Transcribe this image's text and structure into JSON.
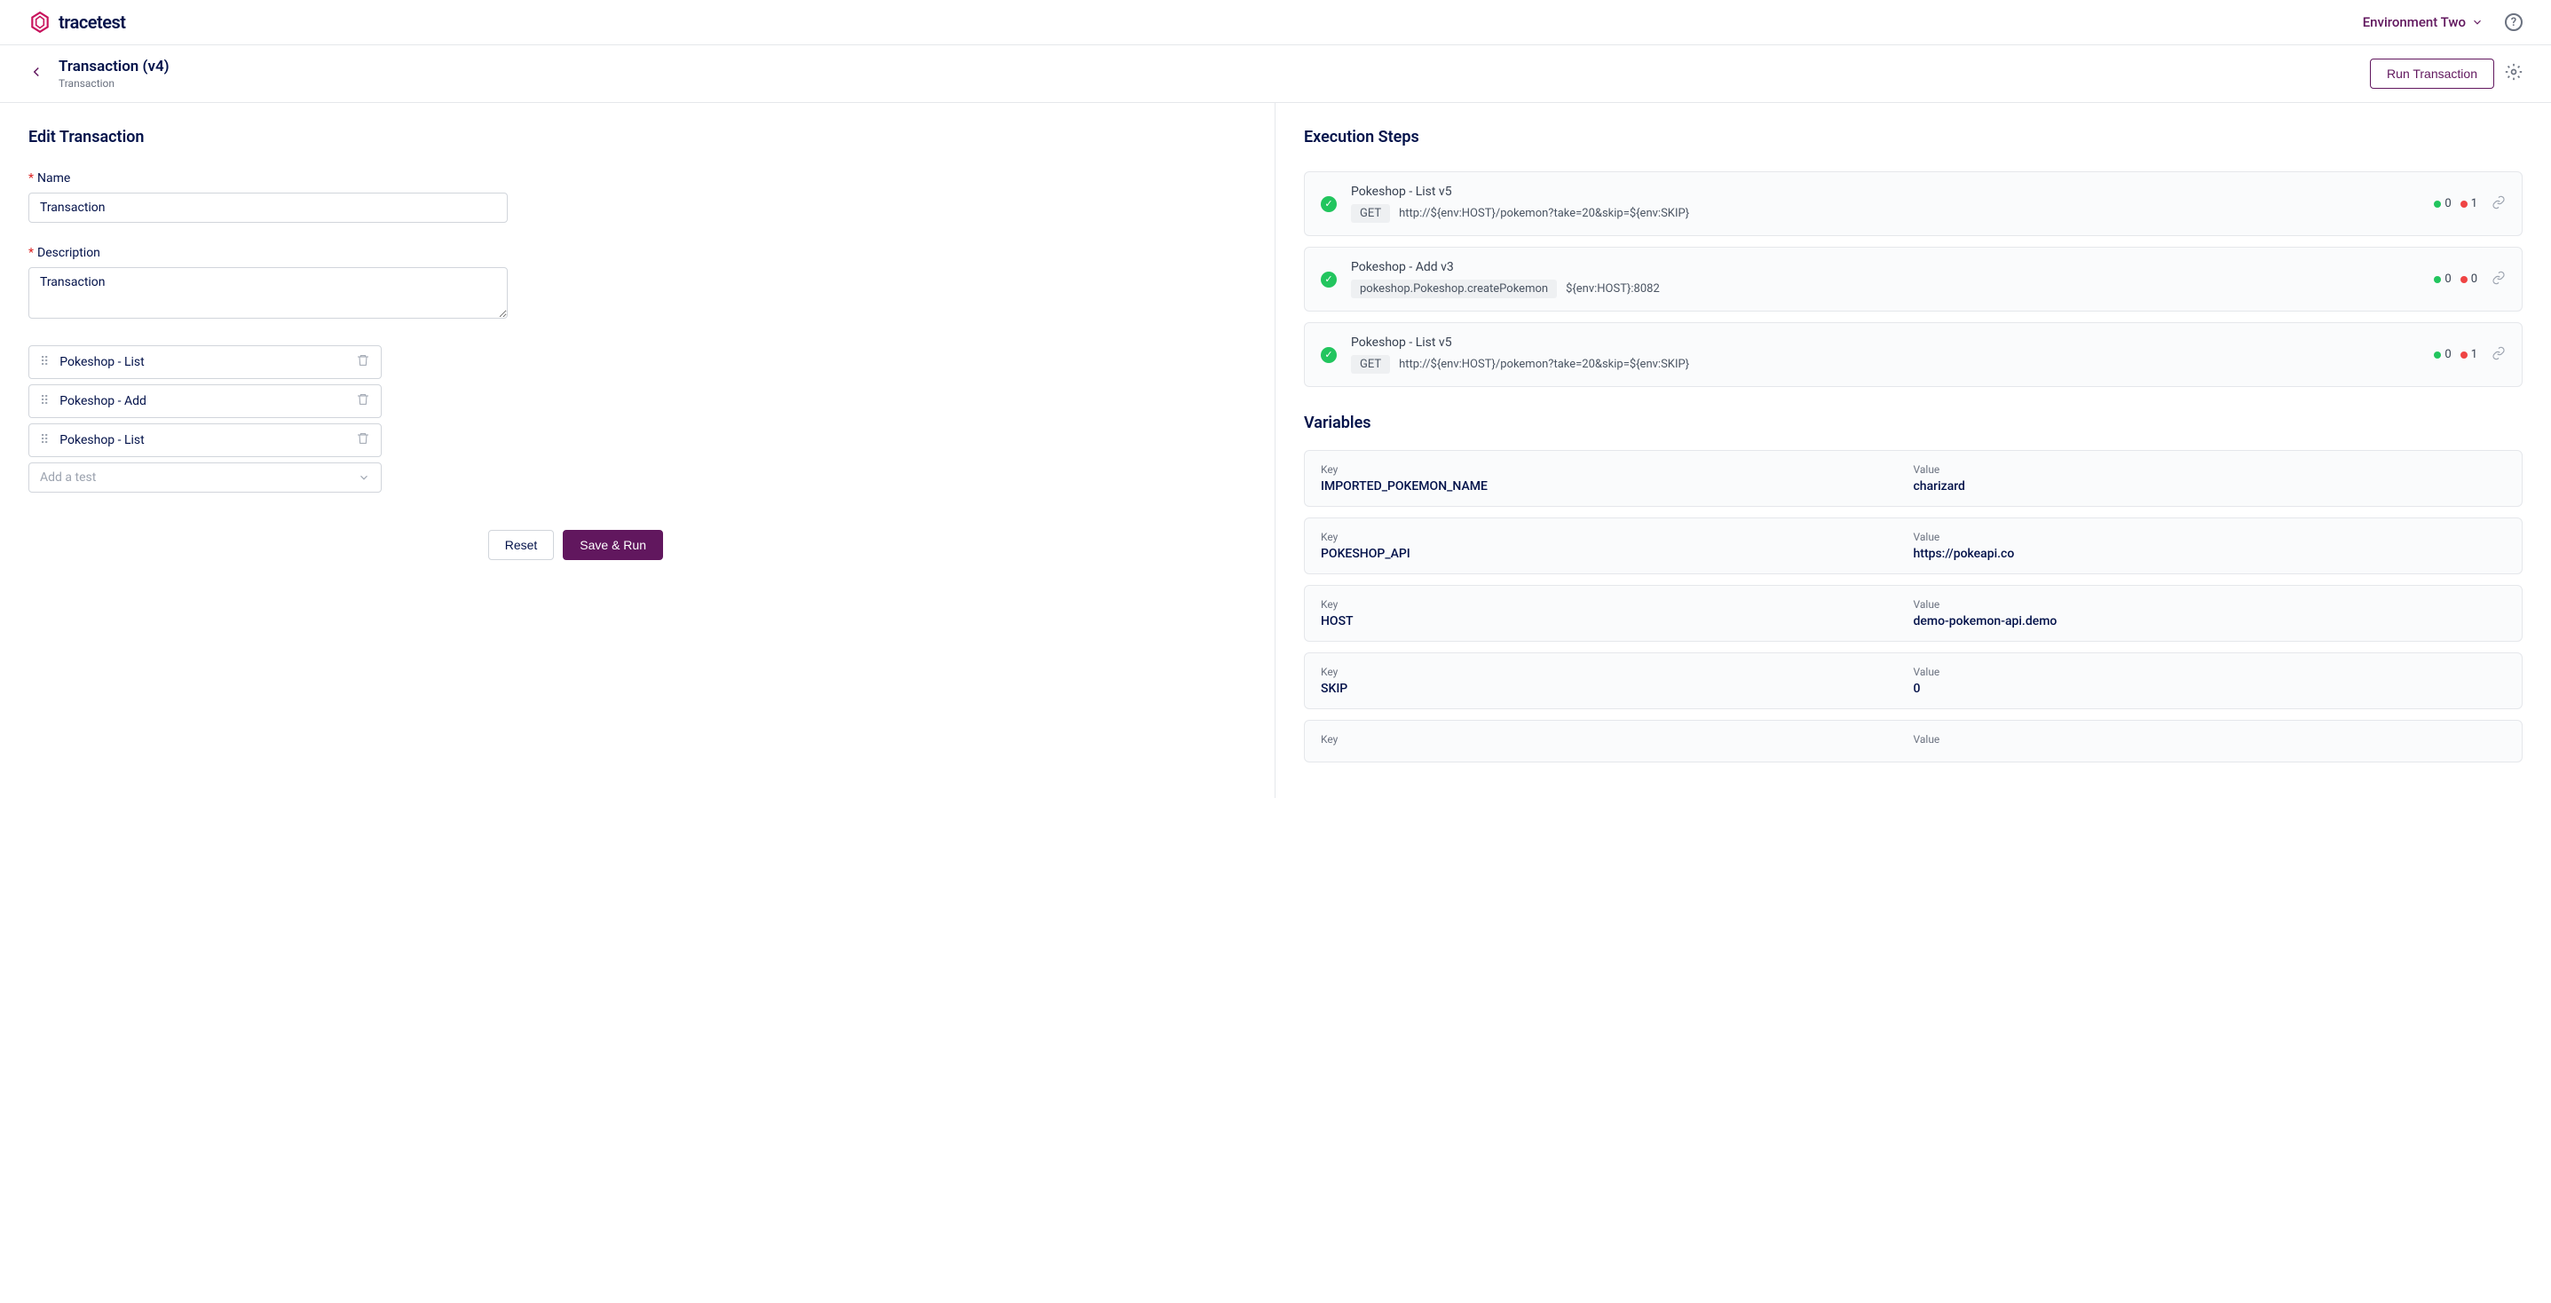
{
  "header": {
    "brand": "tracetest",
    "environment": "Environment Two"
  },
  "subheader": {
    "title": "Transaction (v4)",
    "subtitle": "Transaction",
    "run_label": "Run Transaction"
  },
  "edit": {
    "section_title": "Edit Transaction",
    "name_label": "Name",
    "name_value": "Transaction",
    "desc_label": "Description",
    "desc_value": "Transaction",
    "tests": [
      {
        "name": "Pokeshop - List"
      },
      {
        "name": "Pokeshop - Add"
      },
      {
        "name": "Pokeshop - List"
      }
    ],
    "add_test_placeholder": "Add a test",
    "reset_label": "Reset",
    "save_label": "Save & Run"
  },
  "execution": {
    "section_title": "Execution Steps",
    "steps": [
      {
        "title": "Pokeshop - List v5",
        "method": "GET",
        "url": "http://${env:HOST}/pokemon?take=20&skip=${env:SKIP}",
        "pass": 0,
        "fail": 1
      },
      {
        "title": "Pokeshop - Add v3",
        "method": "pokeshop.Pokeshop.createPokemon",
        "url": "${env:HOST}:8082",
        "pass": 0,
        "fail": 0
      },
      {
        "title": "Pokeshop - List v5",
        "method": "GET",
        "url": "http://${env:HOST}/pokemon?take=20&skip=${env:SKIP}",
        "pass": 0,
        "fail": 1
      }
    ]
  },
  "variables": {
    "section_title": "Variables",
    "key_label": "Key",
    "value_label": "Value",
    "items": [
      {
        "key": "IMPORTED_POKEMON_NAME",
        "value": "charizard"
      },
      {
        "key": "POKESHOP_API",
        "value": "https://pokeapi.co"
      },
      {
        "key": "HOST",
        "value": "demo-pokemon-api.demo"
      },
      {
        "key": "SKIP",
        "value": "0"
      },
      {
        "key": "",
        "value": ""
      }
    ]
  }
}
